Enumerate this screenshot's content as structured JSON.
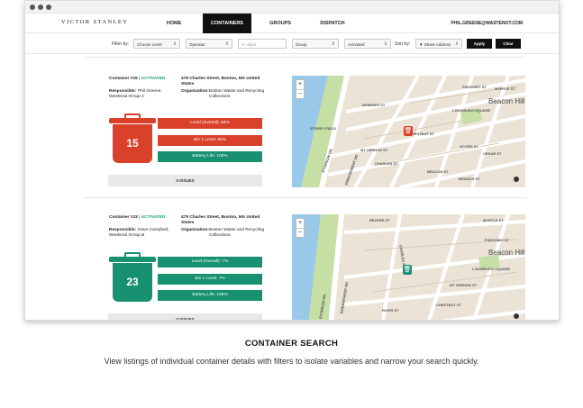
{
  "nav": {
    "brand": "VICTOR STANLEY",
    "items": [
      "HOME",
      "CONTAINERS",
      "GROUPS",
      "DISPATCH"
    ],
    "active": "CONTAINERS",
    "user": "PHIL.GREENE@WASTENOT.COM"
  },
  "filters": {
    "filter_by_label": "Filter by:",
    "level_select": "Choose Level",
    "operator_select": "Operator",
    "value_placeholder": "% Value",
    "group_select": "Group",
    "status_select": "Activated",
    "sort_by_label": "Sort by:",
    "sort_select": "▼ Street Address",
    "apply_label": "Apply",
    "clear_label": "Clear"
  },
  "containers": [
    {
      "title": "Container #15",
      "status": "ACTIVATED",
      "address": "479 Charles Street, Boston, MA  United States",
      "responsible_label": "Responsible:",
      "responsible": "Phil Greene, Weekend Group A",
      "organization_label": "Organization:",
      "organization": "Boston Waste and Recycling Collections",
      "number": "15",
      "color": "#d9412b",
      "level_overall": "Level (Overall): 84%",
      "bin1_level": "Bin 1 Level: 84%",
      "battery": "Battery Life: 100%",
      "issues": "0 ISSUES",
      "map": {
        "labels": [
          "PINCKNEY ST",
          "MYRTLE ST",
          "LOUISBURG SQUARE",
          "MT VERNON ST",
          "CHESTNUT ST",
          "CHARLES ST",
          "BRIMMER ST",
          "BEACON ST",
          "BRANCH ST",
          "ACORN ST",
          "CEDAR ST",
          "STOREY FIELD",
          "EMBANKMENT RD",
          "STORROW DR"
        ],
        "big_label": "Beacon Hill"
      }
    },
    {
      "title": "Container #23",
      "status": "ACTIVATED",
      "address": "479 Charles Street, Boston, MA  United States",
      "responsible_label": "Responsible:",
      "responsible": "Dave Campbell, Weekend Group B",
      "organization_label": "Organization:",
      "organization": "Boston Waste and Recycling Collections",
      "number": "23",
      "color": "#17916f",
      "level_overall": "Level (Overall): 7%",
      "bin1_level": "Bin 1 Level: 7%",
      "battery": "Battery Life: 100%",
      "issues": "0 ISSUES",
      "map": {
        "labels": [
          "REVERE ST",
          "MYRTLE ST",
          "PINCKNEY ST",
          "LOUISBURG SQUARE",
          "MT VERNON ST",
          "CHESTNUT ST",
          "CHARLES ST",
          "RIVER ST",
          "EMBANKMENT RD",
          "STORROW DR"
        ],
        "big_label": "Beacon Hill"
      }
    }
  ],
  "caption": {
    "title": "CONTAINER SEARCH",
    "text": "View listings of individual container details with filters to isolate variables and narrow your search quickly."
  }
}
